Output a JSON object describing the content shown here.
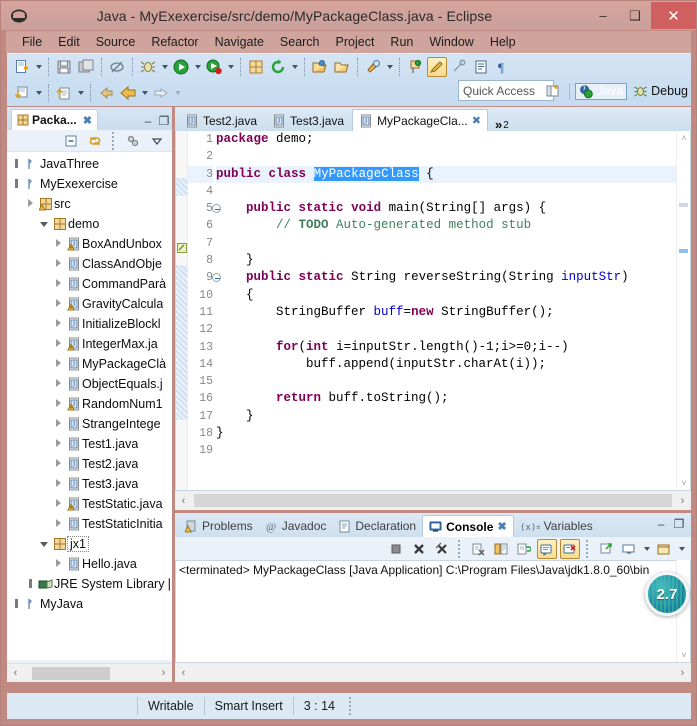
{
  "window": {
    "title": "Java - MyExexercise/src/demo/MyPackageClass.java - Eclipse",
    "minimize_label": "–",
    "maximize_label": "❑",
    "close_label": "✕",
    "logo_icon": "eclipse-logo-icon"
  },
  "menubar": {
    "items": [
      {
        "label": "File"
      },
      {
        "label": "Edit"
      },
      {
        "label": "Source"
      },
      {
        "label": "Refactor"
      },
      {
        "label": "Navigate"
      },
      {
        "label": "Search"
      },
      {
        "label": "Project"
      },
      {
        "label": "Run"
      },
      {
        "label": "Window"
      },
      {
        "label": "Help"
      }
    ]
  },
  "toolbar": {
    "row1": [
      {
        "name": "new-wizard-icon",
        "arrow": true
      },
      {
        "name": "save-icon",
        "arrow": false
      },
      {
        "name": "save-all-icon",
        "arrow": false
      },
      {
        "name": "toggle-breadcrumb-icon",
        "arrow": false
      },
      {
        "name": "debug-icon",
        "arrow": true
      },
      {
        "name": "run-icon",
        "arrow": true
      },
      {
        "name": "coverage-icon",
        "arrow": true
      },
      {
        "name": "new-java-package-icon",
        "arrow": false
      },
      {
        "name": "external-tools-icon",
        "arrow": true
      },
      {
        "name": "open-type-icon",
        "arrow": false
      },
      {
        "name": "open-task-icon",
        "arrow": false
      },
      {
        "name": "search-icon",
        "arrow": true
      },
      {
        "name": "pin-editor-icon",
        "arrow": false
      },
      {
        "name": "marker-icon",
        "arrow": false
      },
      {
        "name": "skip-breakpoints-icon",
        "arrow": false
      },
      {
        "name": "console-view-icon",
        "arrow": false
      },
      {
        "name": "paragraph-icon",
        "arrow": false
      }
    ],
    "row2": [
      {
        "name": "next-annotation-icon",
        "arrow": true
      },
      {
        "name": "previous-annotation-icon",
        "arrow": true
      },
      {
        "name": "back-history-icon",
        "arrow": false
      },
      {
        "name": "forward-back-icon",
        "arrow": true
      },
      {
        "name": "forward-history-icon",
        "arrow": true
      }
    ]
  },
  "quick_access": {
    "placeholder": "Quick Access",
    "value": ""
  },
  "perspectives": {
    "open_perspective_icon": "open-perspective-icon",
    "items": [
      {
        "label": "Java",
        "icon": "java-perspective-icon",
        "selected": true
      },
      {
        "label": "Debug",
        "icon": "debug-perspective-icon",
        "selected": false
      }
    ]
  },
  "package_explorer": {
    "tab_label": "Packa...",
    "tab_icon": "package-explorer-icon",
    "close_label": "✖",
    "minimize_label": "–",
    "maximize_label": "❐",
    "toolbar": [
      {
        "name": "collapse-all-icon"
      },
      {
        "name": "link-with-editor-icon"
      },
      {
        "name": "view-menu-filters-icon"
      },
      {
        "name": "view-menu-icon"
      }
    ],
    "tree": [
      {
        "indent": 0,
        "twisty": "collapsed-small",
        "icon": "java-project-icon",
        "label": "JavaThree"
      },
      {
        "indent": 0,
        "twisty": "collapsed-small",
        "icon": "java-project-icon",
        "label": "MyExexercise"
      },
      {
        "indent": 1,
        "twisty": "collapsed",
        "icon": "source-folder-icon",
        "label": "src"
      },
      {
        "indent": 2,
        "twisty": "expanded",
        "icon": "package-icon",
        "label": "demo"
      },
      {
        "indent": 3,
        "twisty": "collapsed",
        "icon": "java-file-warn-icon",
        "label": "BoxAndUnbox"
      },
      {
        "indent": 3,
        "twisty": "collapsed",
        "icon": "java-file-icon",
        "label": "ClassAndObje"
      },
      {
        "indent": 3,
        "twisty": "collapsed",
        "icon": "java-file-icon",
        "label": "CommandParà"
      },
      {
        "indent": 3,
        "twisty": "collapsed",
        "icon": "java-file-warn-icon",
        "label": "GravityCalcula"
      },
      {
        "indent": 3,
        "twisty": "collapsed",
        "icon": "java-file-icon",
        "label": "InitializeBlockl"
      },
      {
        "indent": 3,
        "twisty": "collapsed",
        "icon": "java-file-warn-icon",
        "label": "IntegerMax.ja"
      },
      {
        "indent": 3,
        "twisty": "collapsed",
        "icon": "java-file-icon",
        "label": "MyPackageClà"
      },
      {
        "indent": 3,
        "twisty": "collapsed",
        "icon": "java-file-icon",
        "label": "ObjectEquals.j"
      },
      {
        "indent": 3,
        "twisty": "collapsed",
        "icon": "java-file-warn-icon",
        "label": "RandomNum1"
      },
      {
        "indent": 3,
        "twisty": "collapsed",
        "icon": "java-file-icon",
        "label": "StrangeIntege"
      },
      {
        "indent": 3,
        "twisty": "collapsed",
        "icon": "java-file-icon",
        "label": "Test1.java"
      },
      {
        "indent": 3,
        "twisty": "collapsed",
        "icon": "java-file-icon",
        "label": "Test2.java"
      },
      {
        "indent": 3,
        "twisty": "collapsed",
        "icon": "java-file-icon",
        "label": "Test3.java"
      },
      {
        "indent": 3,
        "twisty": "collapsed",
        "icon": "java-file-warn-icon",
        "label": "TestStatic.java"
      },
      {
        "indent": 3,
        "twisty": "collapsed",
        "icon": "java-file-icon",
        "label": "TestStaticInitia"
      },
      {
        "indent": 2,
        "twisty": "expanded",
        "icon": "package-icon",
        "label": "jx1",
        "focused": true
      },
      {
        "indent": 3,
        "twisty": "collapsed",
        "icon": "java-file-icon",
        "label": "Hello.java"
      },
      {
        "indent": 1,
        "twisty": "collapsed-small",
        "icon": "jre-library-icon",
        "label": "JRE System Library ["
      },
      {
        "indent": 0,
        "twisty": "collapsed-small",
        "icon": "java-project-icon",
        "label": "MyJava"
      }
    ],
    "hscroll": {
      "left_arrow": "‹",
      "right_arrow": "›"
    }
  },
  "editor": {
    "tabs": [
      {
        "label": "Test2.java",
        "icon": "java-file-icon",
        "active": false,
        "closable": false
      },
      {
        "label": "Test3.java",
        "icon": "java-file-icon",
        "active": false,
        "closable": false
      },
      {
        "label": "MyPackageCla...",
        "icon": "java-file-icon",
        "active": true,
        "closable": true,
        "close_label": "✖"
      }
    ],
    "overflow": {
      "chevron": "»",
      "count": "2"
    },
    "minimize_label": "–",
    "maximize_label": "❐",
    "scroll_up": "˄",
    "scroll_down": "˅",
    "hscroll": {
      "left_arrow": "‹",
      "right_arrow": "›"
    },
    "lines": [
      {
        "n": "1",
        "fold": false,
        "current": false,
        "tokens": [
          {
            "t": "package",
            "c": "kw"
          },
          {
            "t": " demo;",
            "c": ""
          }
        ]
      },
      {
        "n": "2",
        "fold": false,
        "current": false,
        "tokens": []
      },
      {
        "n": "3",
        "fold": false,
        "current": true,
        "tokens": [
          {
            "t": "public",
            "c": "kw"
          },
          {
            "t": " ",
            "c": ""
          },
          {
            "t": "class",
            "c": "kw"
          },
          {
            "t": " ",
            "c": ""
          },
          {
            "t": "MyPackageClass",
            "c": "sel"
          },
          {
            "t": " {",
            "c": ""
          }
        ]
      },
      {
        "n": "4",
        "fold": false,
        "current": false,
        "tokens": []
      },
      {
        "n": "5",
        "fold": true,
        "current": false,
        "tokens": [
          {
            "t": "    ",
            "c": ""
          },
          {
            "t": "public",
            "c": "kw"
          },
          {
            "t": " ",
            "c": ""
          },
          {
            "t": "static",
            "c": "kw"
          },
          {
            "t": " ",
            "c": ""
          },
          {
            "t": "void",
            "c": "kw"
          },
          {
            "t": " main(String[] args) {",
            "c": ""
          }
        ]
      },
      {
        "n": "6",
        "fold": false,
        "current": false,
        "tokens": [
          {
            "t": "        ",
            "c": ""
          },
          {
            "t": "// ",
            "c": "cmt"
          },
          {
            "t": "TODO",
            "c": "todo"
          },
          {
            "t": " Auto-generated method stub",
            "c": "cmt"
          }
        ]
      },
      {
        "n": "7",
        "fold": false,
        "current": false,
        "tokens": []
      },
      {
        "n": "8",
        "fold": false,
        "current": false,
        "tokens": [
          {
            "t": "    }",
            "c": ""
          }
        ]
      },
      {
        "n": "9",
        "fold": true,
        "current": false,
        "tokens": [
          {
            "t": "    ",
            "c": ""
          },
          {
            "t": "public",
            "c": "kw"
          },
          {
            "t": " ",
            "c": ""
          },
          {
            "t": "static",
            "c": "kw"
          },
          {
            "t": " String reverseString(String ",
            "c": ""
          },
          {
            "t": "inputStr",
            "c": "fld"
          },
          {
            "t": ")",
            "c": ""
          }
        ]
      },
      {
        "n": "10",
        "fold": false,
        "current": false,
        "tokens": [
          {
            "t": "    {",
            "c": ""
          }
        ]
      },
      {
        "n": "11",
        "fold": false,
        "current": false,
        "tokens": [
          {
            "t": "        StringBuffer ",
            "c": ""
          },
          {
            "t": "buff",
            "c": "fld"
          },
          {
            "t": "=",
            "c": ""
          },
          {
            "t": "new",
            "c": "kw"
          },
          {
            "t": " StringBuffer();",
            "c": ""
          }
        ]
      },
      {
        "n": "12",
        "fold": false,
        "current": false,
        "tokens": []
      },
      {
        "n": "13",
        "fold": false,
        "current": false,
        "tokens": [
          {
            "t": "        ",
            "c": ""
          },
          {
            "t": "for",
            "c": "kw"
          },
          {
            "t": "(",
            "c": ""
          },
          {
            "t": "int",
            "c": "kw"
          },
          {
            "t": " i=inputStr.length()-1;i>=0;i--)",
            "c": ""
          }
        ]
      },
      {
        "n": "14",
        "fold": false,
        "current": false,
        "tokens": [
          {
            "t": "            buff.append(inputStr.charAt(i));",
            "c": ""
          }
        ]
      },
      {
        "n": "15",
        "fold": false,
        "current": false,
        "tokens": []
      },
      {
        "n": "16",
        "fold": false,
        "current": false,
        "tokens": [
          {
            "t": "        ",
            "c": ""
          },
          {
            "t": "return",
            "c": "kw"
          },
          {
            "t": " buff.toString();",
            "c": ""
          }
        ]
      },
      {
        "n": "17",
        "fold": false,
        "current": false,
        "tokens": [
          {
            "t": "    }",
            "c": ""
          }
        ]
      },
      {
        "n": "18",
        "fold": false,
        "current": false,
        "tokens": [
          {
            "t": "}",
            "c": ""
          }
        ]
      },
      {
        "n": "19",
        "fold": false,
        "current": false,
        "tokens": []
      }
    ]
  },
  "console": {
    "tabs": [
      {
        "label": "Problems",
        "icon": "problems-icon",
        "active": false
      },
      {
        "label": "Javadoc",
        "icon": "javadoc-icon",
        "active": false
      },
      {
        "label": "Declaration",
        "icon": "declaration-icon",
        "active": false
      },
      {
        "label": "Console",
        "icon": "console-icon",
        "active": true,
        "close_label": "✖"
      },
      {
        "label": "Variables",
        "icon": "variables-icon",
        "active": false
      }
    ],
    "minimize_label": "–",
    "maximize_label": "❐",
    "toolbar": [
      {
        "name": "terminate-icon"
      },
      {
        "name": "remove-launch-icon"
      },
      {
        "name": "remove-all-terminated-icon"
      },
      {
        "name": "clear-console-icon"
      },
      {
        "name": "scroll-lock-icon"
      },
      {
        "name": "word-wrap-icon"
      },
      {
        "name": "show-console-on-output-icon"
      },
      {
        "name": "show-console-on-error-icon"
      },
      {
        "name": "pin-console-icon"
      },
      {
        "name": "display-selected-console-icon"
      },
      {
        "name": "open-console-icon"
      }
    ],
    "output": "<terminated> MyPackageClass [Java Application] C:\\Program Files\\Java\\jdk1.8.0_60\\bin",
    "hscroll": {
      "left_arrow": "‹",
      "right_arrow": "›"
    },
    "scroll_down": "˅"
  },
  "badge": {
    "value": "2.7"
  },
  "statusbar": {
    "writable": "Writable",
    "insert_mode": "Smart Insert",
    "position": "3 : 14"
  },
  "colors": {
    "title_bg": "#d3a29b",
    "toolbar_bg": "#cbdff1",
    "accent_blue": "#3399ff",
    "keyword": "#7f0055",
    "comment": "#3f7f5f",
    "field": "#0000c0",
    "close_btn": "#d0605f"
  }
}
